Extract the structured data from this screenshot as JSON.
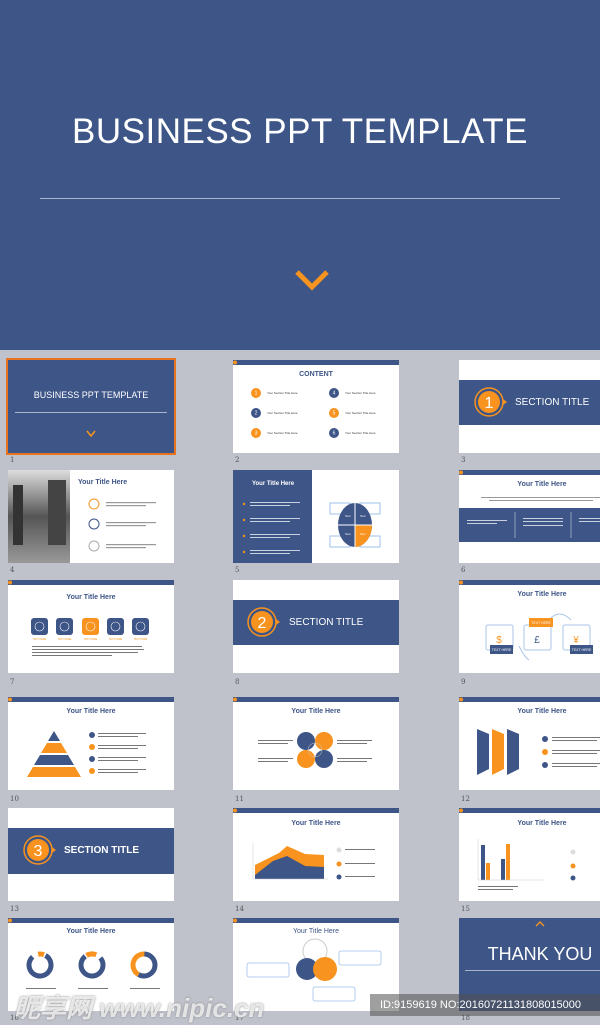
{
  "main": {
    "title": "BUSINESS PPT TEMPLATE"
  },
  "colors": {
    "blue": "#3d5587",
    "orange": "#f7931e",
    "background": "#bfc1cb"
  },
  "slides": {
    "s1": {
      "title": "BUSINESS PPT TEMPLATE",
      "num": "1"
    },
    "s2": {
      "title": "CONTENT",
      "num": "2",
      "items": [
        {
          "n": "1",
          "label": "Your Section Title Here"
        },
        {
          "n": "2",
          "label": "Your Section Title Here"
        },
        {
          "n": "3",
          "label": "Your Section Title Here"
        },
        {
          "n": "4",
          "label": "Your Section Title Here"
        },
        {
          "n": "5",
          "label": "Your Section Title Here"
        },
        {
          "n": "6",
          "label": "Your Section Title Here"
        }
      ]
    },
    "s3": {
      "n": "1",
      "title": "SECTION TITLE",
      "num": "3"
    },
    "s4": {
      "title": "Your Title Here",
      "num": "4"
    },
    "s5": {
      "title": "Your Title Here",
      "num": "5",
      "text": "Text"
    },
    "s6": {
      "title": "Your Title Here",
      "num": "6"
    },
    "s7": {
      "title": "Your Title Here",
      "num": "7",
      "label": "TEXT HERE"
    },
    "s8": {
      "n": "2",
      "title": "SECTION TITLE",
      "num": "8"
    },
    "s9": {
      "title": "Your Title Here",
      "num": "9",
      "label": "TEXT HERE",
      "symbols": [
        "$",
        "£",
        "¥"
      ]
    },
    "s10": {
      "title": "Your Title Here",
      "num": "10"
    },
    "s11": {
      "title": "Your Title Here",
      "num": "11"
    },
    "s12": {
      "title": "Your Title Here",
      "num": "12"
    },
    "s13": {
      "n": "3",
      "title": "SECTION TITLE",
      "num": "13"
    },
    "s14": {
      "title": "Your Title Here",
      "num": "14"
    },
    "s15": {
      "title": "Your Title Here",
      "num": "15"
    },
    "s16": {
      "title": "Your Title Here",
      "num": "16"
    },
    "s17": {
      "title": "Your Title Here",
      "num": "17"
    },
    "s18": {
      "title": "THANK YOU",
      "num": "18"
    }
  },
  "watermark": {
    "logo": "昵享网 www.nipic.cn",
    "id": "ID:9159619 NO:20160721131808015000"
  }
}
